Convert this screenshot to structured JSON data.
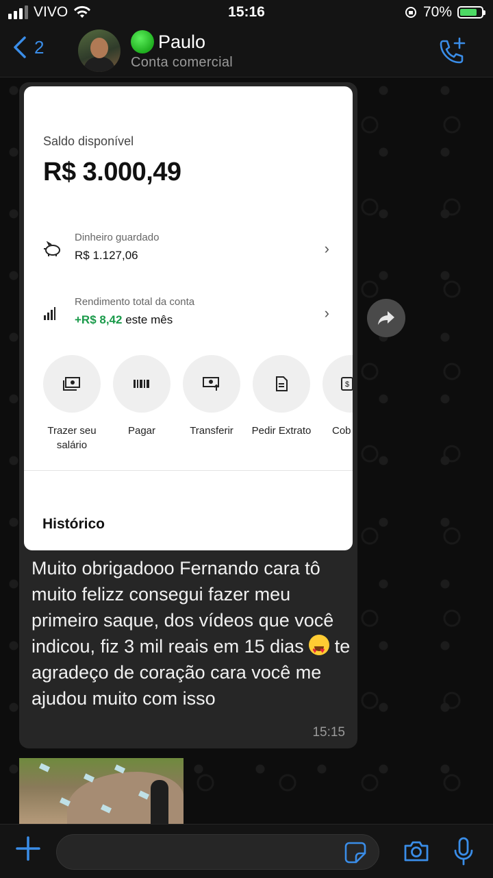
{
  "status_bar": {
    "carrier": "VIVO",
    "time": "15:16",
    "battery": "70%"
  },
  "header": {
    "back_count": "2",
    "contact_name": "Paulo",
    "contact_subtitle": "Conta comercial",
    "icons": {
      "back": "chevron-left-icon",
      "call": "add-call-icon",
      "presence": "green-circle-emoji"
    }
  },
  "screenshot": {
    "balance_label": "Saldo disponível",
    "balance_value": "R$ 3.000,49",
    "saved_label": "Dinheiro guardado",
    "saved_value": "R$ 1.127,06",
    "yield_label": "Rendimento total da conta",
    "yield_value": "+R$ 8,42",
    "yield_suffix": "este mês",
    "actions": [
      {
        "label": "Trazer seu\nsalário",
        "icon": "salary-icon"
      },
      {
        "label": "Pagar",
        "icon": "barcode-icon"
      },
      {
        "label": "Transferir",
        "icon": "transfer-icon"
      },
      {
        "label": "Pedir Extrato",
        "icon": "document-icon"
      },
      {
        "label": "Cob",
        "icon": "charge-icon"
      }
    ],
    "history_label": "Histórico"
  },
  "message": {
    "text_before_emoji": "Muito obrigadooo Fernando cara tô muito felizz consegui fazer meu primeiro saque, dos vídeos que você indicou, fiz 3 mil reais em 15 dias",
    "emoji": "heart-eyes-emoji",
    "text_after_emoji": " te agradeço de coração cara você me ajudou muito com isso",
    "time": "15:15"
  },
  "colors": {
    "accent": "#3a8de8",
    "bubble": "#262626",
    "positive": "#1a9a4a"
  }
}
